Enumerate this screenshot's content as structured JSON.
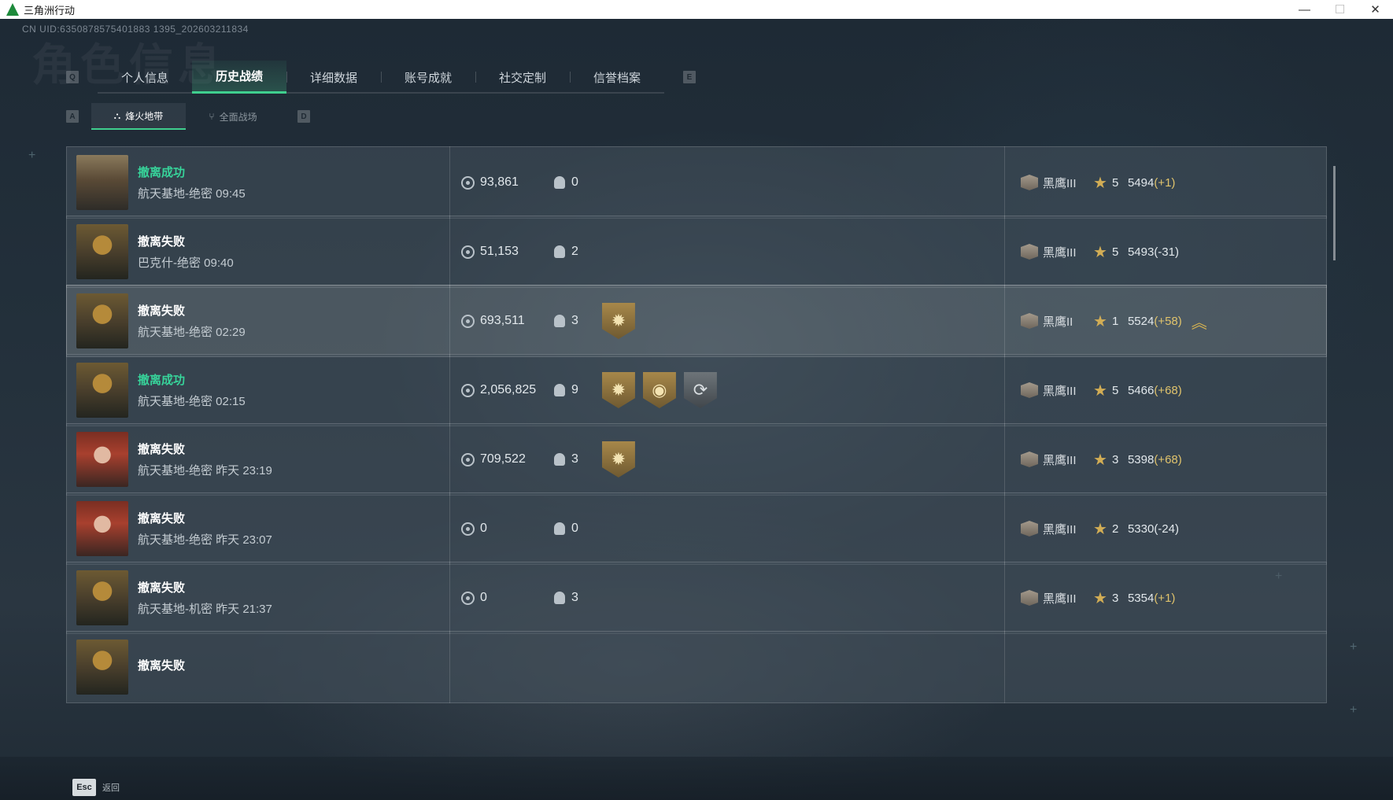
{
  "window": {
    "title": "三角洲行动",
    "minimize": "—",
    "maximize": "☐",
    "close": "✕"
  },
  "header": {
    "uid": "CN UID:6350878575401883 1395_202603211834",
    "ghost_title": "角色信息"
  },
  "tabs": {
    "prev_key": "Q",
    "next_key": "E",
    "items": [
      {
        "label": "个人信息"
      },
      {
        "label": "历史战绩",
        "active": true
      },
      {
        "label": "详细数据"
      },
      {
        "label": "账号成就"
      },
      {
        "label": "社交定制"
      },
      {
        "label": "信誉档案"
      }
    ]
  },
  "subtabs": {
    "prev_key": "A",
    "next_key": "D",
    "items": [
      {
        "label": "烽火地带",
        "icon": "⛬",
        "active": true
      },
      {
        "label": "全面战场",
        "icon": "⑂"
      }
    ]
  },
  "records": [
    {
      "status": "撤离成功",
      "success": true,
      "map": "航天基地-绝密 09:45",
      "avatar": "male",
      "money": "93,861",
      "kills": "0",
      "badges": [],
      "rank": "黑鹰III",
      "stars": "5",
      "score": "5494",
      "delta": "(+1)",
      "delta_positive": true
    },
    {
      "status": "撤离失败",
      "success": false,
      "map": "巴克什-绝密 09:40",
      "avatar": "helmet",
      "money": "51,153",
      "kills": "2",
      "badges": [],
      "rank": "黑鹰III",
      "stars": "5",
      "score": "5493",
      "delta": "(-31)",
      "delta_positive": false
    },
    {
      "status": "撤离失败",
      "success": false,
      "map": "航天基地-绝密 02:29",
      "avatar": "helmet",
      "money": "693,511",
      "kills": "3",
      "badges": [
        "gold-sun"
      ],
      "rank": "黑鹰II",
      "stars": "1",
      "score": "5524",
      "delta": "(+58)",
      "delta_positive": true,
      "promoted": true,
      "highlight": true
    },
    {
      "status": "撤离成功",
      "success": true,
      "map": "航天基地-绝密 02:15",
      "avatar": "helmet",
      "money": "2,056,825",
      "kills": "9",
      "badges": [
        "gold-sun",
        "gold-coin",
        "silver-cycle"
      ],
      "rank": "黑鹰III",
      "stars": "5",
      "score": "5466",
      "delta": "(+68)",
      "delta_positive": true
    },
    {
      "status": "撤离失败",
      "success": false,
      "map": "航天基地-绝密 昨天 23:19",
      "avatar": "female",
      "money": "709,522",
      "kills": "3",
      "badges": [
        "gold-sun"
      ],
      "rank": "黑鹰III",
      "stars": "3",
      "score": "5398",
      "delta": "(+68)",
      "delta_positive": true
    },
    {
      "status": "撤离失败",
      "success": false,
      "map": "航天基地-绝密 昨天 23:07",
      "avatar": "female",
      "money": "0",
      "kills": "0",
      "badges": [],
      "rank": "黑鹰III",
      "stars": "2",
      "score": "5330",
      "delta": "(-24)",
      "delta_positive": false
    },
    {
      "status": "撤离失败",
      "success": false,
      "map": "航天基地-机密 昨天 21:37",
      "avatar": "helmet",
      "money": "0",
      "kills": "3",
      "badges": [],
      "rank": "黑鹰III",
      "stars": "3",
      "score": "5354",
      "delta": "(+1)",
      "delta_positive": true
    },
    {
      "status": "撤离失败",
      "success": false,
      "map": "",
      "avatar": "helmet",
      "money": "",
      "kills": "",
      "badges": [],
      "rank": "",
      "stars": "",
      "score": "",
      "delta": "",
      "delta_positive": false,
      "partial": true
    }
  ],
  "footer": {
    "esc_key": "Esc",
    "back_label": "返回"
  },
  "colors": {
    "accent": "#3fcf8e",
    "success": "#37d39a",
    "gold": "#d2ad55"
  }
}
